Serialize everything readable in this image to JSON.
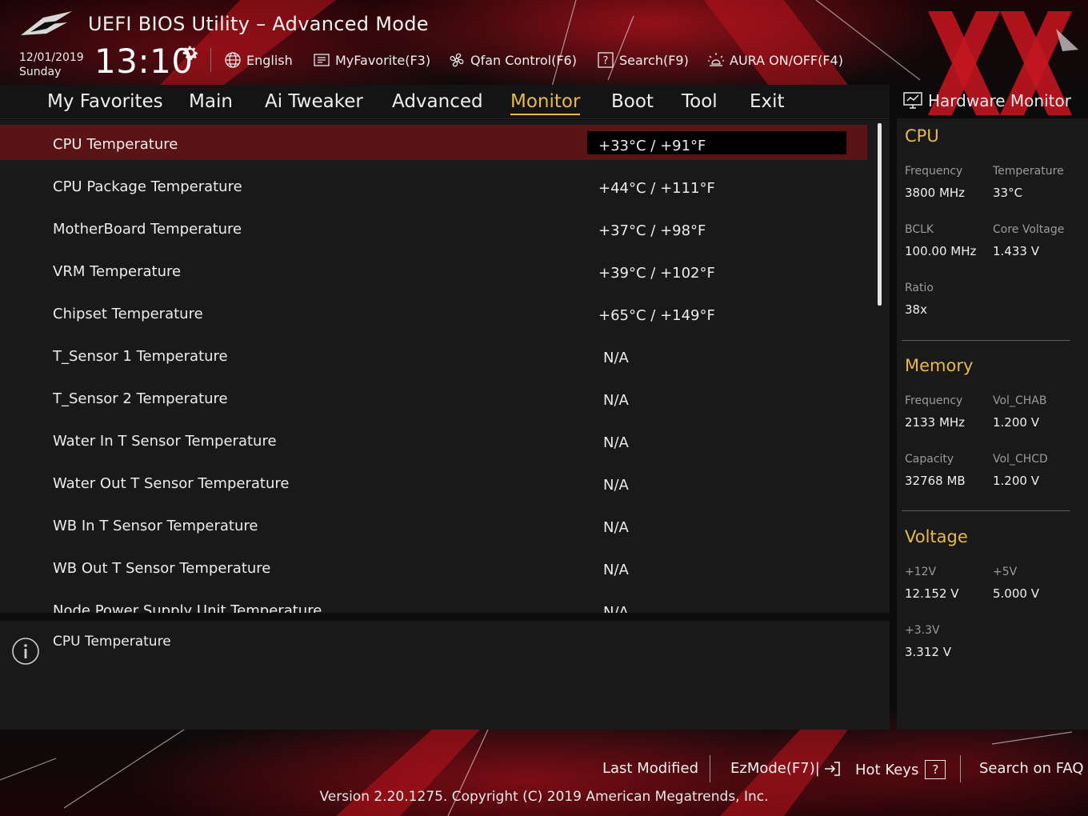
{
  "header": {
    "title": "UEFI BIOS Utility – Advanced Mode",
    "date": "12/01/2019",
    "day": "Sunday",
    "time": "13:10",
    "toolbar": {
      "language": "English",
      "favorite": "MyFavorite(F3)",
      "qfan": "Qfan Control(F6)",
      "search": "Search(F9)",
      "aura": "AURA ON/OFF(F4)"
    }
  },
  "nav": {
    "tabs": [
      "My Favorites",
      "Main",
      "Ai Tweaker",
      "Advanced",
      "Monitor",
      "Boot",
      "Tool",
      "Exit"
    ],
    "active": "Monitor"
  },
  "rows": [
    {
      "label": "CPU Temperature",
      "value": "+33°C / +91°F",
      "selected": true
    },
    {
      "label": "CPU Package Temperature",
      "value": "+44°C / +111°F"
    },
    {
      "label": "MotherBoard Temperature",
      "value": "+37°C / +98°F"
    },
    {
      "label": "VRM Temperature",
      "value": "+39°C / +102°F"
    },
    {
      "label": "Chipset Temperature",
      "value": "+65°C / +149°F"
    },
    {
      "label": "T_Sensor 1 Temperature",
      "value": "N/A"
    },
    {
      "label": "T_Sensor 2 Temperature",
      "value": "N/A"
    },
    {
      "label": "Water In T Sensor Temperature",
      "value": "N/A"
    },
    {
      "label": "Water Out T Sensor Temperature",
      "value": "N/A"
    },
    {
      "label": "WB In T Sensor Temperature",
      "value": "N/A"
    },
    {
      "label": "WB Out T Sensor Temperature",
      "value": "N/A"
    },
    {
      "label": "Node Power Supply Unit Temperature",
      "value": "N/A"
    }
  ],
  "help": {
    "text": "CPU Temperature"
  },
  "hw_monitor": {
    "title": "Hardware Monitor",
    "cpu": {
      "heading": "CPU",
      "frequency_label": "Frequency",
      "frequency": "3800 MHz",
      "temperature_label": "Temperature",
      "temperature": "33°C",
      "bclk_label": "BCLK",
      "bclk": "100.00 MHz",
      "core_voltage_label": "Core Voltage",
      "core_voltage": "1.433 V",
      "ratio_label": "Ratio",
      "ratio": "38x"
    },
    "memory": {
      "heading": "Memory",
      "frequency_label": "Frequency",
      "frequency": "2133 MHz",
      "vol_chab_label": "Vol_CHAB",
      "vol_chab": "1.200 V",
      "capacity_label": "Capacity",
      "capacity": "32768 MB",
      "vol_chcd_label": "Vol_CHCD",
      "vol_chcd": "1.200 V"
    },
    "voltage": {
      "heading": "Voltage",
      "v12_label": "+12V",
      "v12": "12.152 V",
      "v5_label": "+5V",
      "v5": "5.000 V",
      "v33_label": "+3.3V",
      "v33": "3.312 V"
    }
  },
  "footer": {
    "last_modified": "Last Modified",
    "ezmode": "EzMode(F7)|",
    "hotkeys": "Hot Keys",
    "hotkeys_key": "?",
    "faq": "Search on FAQ",
    "version": "Version 2.20.1275. Copyright (C) 2019 American Megatrends, Inc."
  },
  "colors": {
    "accent": "#e9b84a",
    "selected_row": "#5b1416",
    "brand_red": "#c0121e",
    "panel": "#191919"
  },
  "icons": {
    "logo": "rog-eye-logo",
    "settings": "gear-icon",
    "language": "globe-icon",
    "favorite": "favorite-list-icon",
    "qfan": "fan-icon",
    "search": "search-icon",
    "aura": "aura-light-icon",
    "hw_monitor": "monitor-icon",
    "info": "info-icon",
    "ezmode": "exit-arrow-icon"
  }
}
